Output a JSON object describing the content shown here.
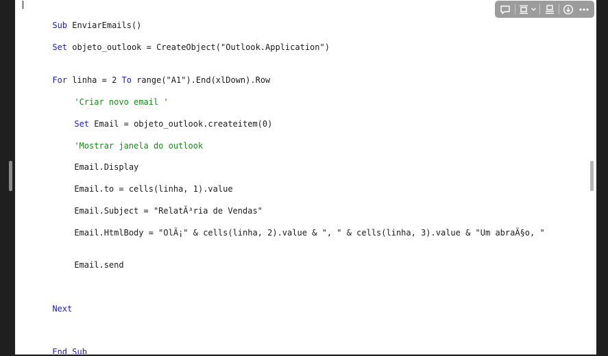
{
  "code": {
    "lines": [
      {
        "parts": [
          {
            "t": "Sub ",
            "c": "kw"
          },
          {
            "t": "EnviarEmails()",
            "c": ""
          }
        ]
      },
      {
        "parts": [
          {
            "t": "Set ",
            "c": "kw"
          },
          {
            "t": "objeto_outlook = CreateObject(\"Outlook.Application\")",
            "c": ""
          }
        ]
      },
      {
        "parts": [
          {
            "t": "For ",
            "c": "kw"
          },
          {
            "t": "linha = 2 ",
            "c": ""
          },
          {
            "t": "To ",
            "c": "kw"
          },
          {
            "t": "range(\"A1\").End(xlDown).Row",
            "c": ""
          }
        ]
      },
      {
        "parts": [
          {
            "t": "'Criar novo email '",
            "c": "cm"
          }
        ]
      },
      {
        "parts": [
          {
            "t": "Set ",
            "c": "kw"
          },
          {
            "t": "Email = objeto_outlook.createitem(0)",
            "c": ""
          }
        ]
      },
      {
        "parts": [
          {
            "t": "'Mostrar janela do outlook",
            "c": "cm"
          }
        ]
      },
      {
        "parts": [
          {
            "t": "Email.Display",
            "c": ""
          }
        ]
      },
      {
        "parts": [
          {
            "t": "Email.to = cells(linha, 1).value",
            "c": ""
          }
        ]
      },
      {
        "parts": [
          {
            "t": "Email.Subject = \"RelatÃ³ria de Vendas\"",
            "c": ""
          }
        ]
      },
      {
        "parts": [
          {
            "t": "Email.HtmlBody = \"OlÃ¡\" & cells(linha, 2).value & \", \" & cells(linha, 3).value & \"Um abraÃ§o, \"",
            "c": ""
          }
        ]
      },
      {
        "parts": [
          {
            "t": "Email.send",
            "c": ""
          }
        ]
      },
      {
        "parts": [
          {
            "t": "Next",
            "c": "kw"
          }
        ]
      },
      {
        "parts": [
          {
            "t": "End Sub",
            "c": "kw"
          }
        ]
      }
    ]
  },
  "toolbar": {
    "icons": [
      "comment-icon",
      "wrap-image-icon",
      "chevron-down-icon",
      "align-top-icon",
      "download-icon",
      "more-icon"
    ]
  },
  "colors": {
    "keyword": "#1a1ac8",
    "comment": "#168a16",
    "text": "#1a1a1a",
    "toolbar_bg": "#9c9c9c"
  }
}
